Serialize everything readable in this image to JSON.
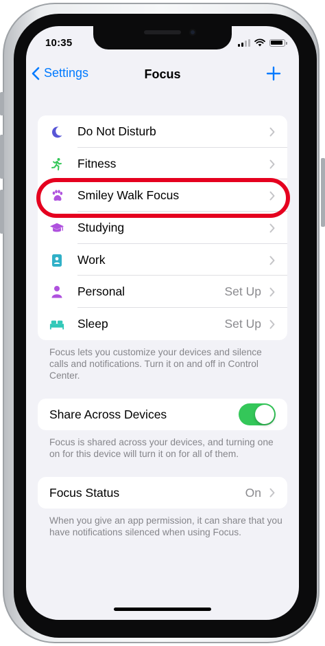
{
  "status_bar": {
    "time": "10:35"
  },
  "nav": {
    "back_label": "Settings",
    "title": "Focus",
    "add_icon": "plus-icon"
  },
  "focus_modes": [
    {
      "label": "Do Not Disturb",
      "value": "",
      "icon": "moon-icon",
      "icon_color": "#5856d6"
    },
    {
      "label": "Fitness",
      "value": "",
      "icon": "running-figure-icon",
      "icon_color": "#34c759"
    },
    {
      "label": "Smiley Walk Focus",
      "value": "",
      "icon": "paw-print-icon",
      "icon_color": "#af52de"
    },
    {
      "label": "Studying",
      "value": "",
      "icon": "graduation-cap-icon",
      "icon_color": "#af52de"
    },
    {
      "label": "Work",
      "value": "",
      "icon": "id-badge-icon",
      "icon_color": "#30b0c7"
    },
    {
      "label": "Personal",
      "value": "Set Up",
      "icon": "person-icon",
      "icon_color": "#af52de"
    },
    {
      "label": "Sleep",
      "value": "Set Up",
      "icon": "bed-icon",
      "icon_color": "#30c8b8"
    }
  ],
  "focus_footnote": "Focus lets you customize your devices and silence calls and notifications. Turn it on and off in Control Center.",
  "share": {
    "label": "Share Across Devices",
    "enabled": true,
    "toggle_color": "#34c759",
    "footnote": "Focus is shared across your devices, and turning one on for this device will turn it on for all of them."
  },
  "focus_status": {
    "label": "Focus Status",
    "value": "On",
    "footnote": "When you give an app permission, it can share that you have notifications silenced when using Focus."
  },
  "colors": {
    "accent": "#007aff",
    "highlight": "#e5001f",
    "background": "#f2f2f7"
  }
}
